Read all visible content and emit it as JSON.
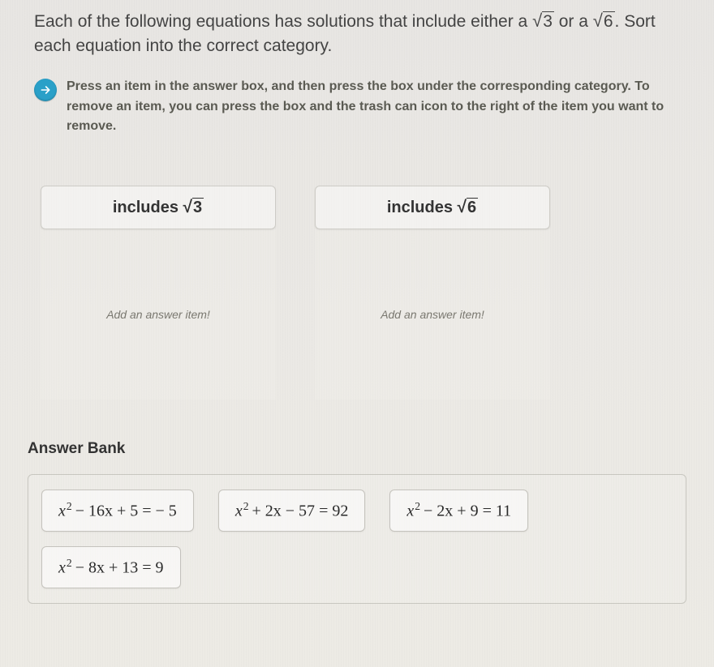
{
  "intro": {
    "part1": "Each of the following equations has solutions that include either a ",
    "sqrt1_radicand": "3",
    "mid": " or a ",
    "sqrt2_radicand": "6",
    "part2": ". Sort each equation into the correct category."
  },
  "instruction": "Press an item in the answer box, and then press the box under the corresponding category. To remove an item, you can press the box and the trash can icon to the right of the item you want to remove.",
  "categories": [
    {
      "label_prefix": "includes ",
      "radicand": "3",
      "placeholder": "Add an answer item!"
    },
    {
      "label_prefix": "includes ",
      "radicand": "6",
      "placeholder": "Add an answer item!"
    }
  ],
  "answer_bank_label": "Answer Bank",
  "answer_items": [
    {
      "lhs_a": "x",
      "lhs_b": "− 16x + 5",
      "rhs": "− 5"
    },
    {
      "lhs_a": "x",
      "lhs_b": "+ 2x − 57",
      "rhs": "92"
    },
    {
      "lhs_a": "x",
      "lhs_b": "− 2x + 9",
      "rhs": "11"
    },
    {
      "lhs_a": "x",
      "lhs_b": "− 8x + 13",
      "rhs": "9"
    }
  ]
}
